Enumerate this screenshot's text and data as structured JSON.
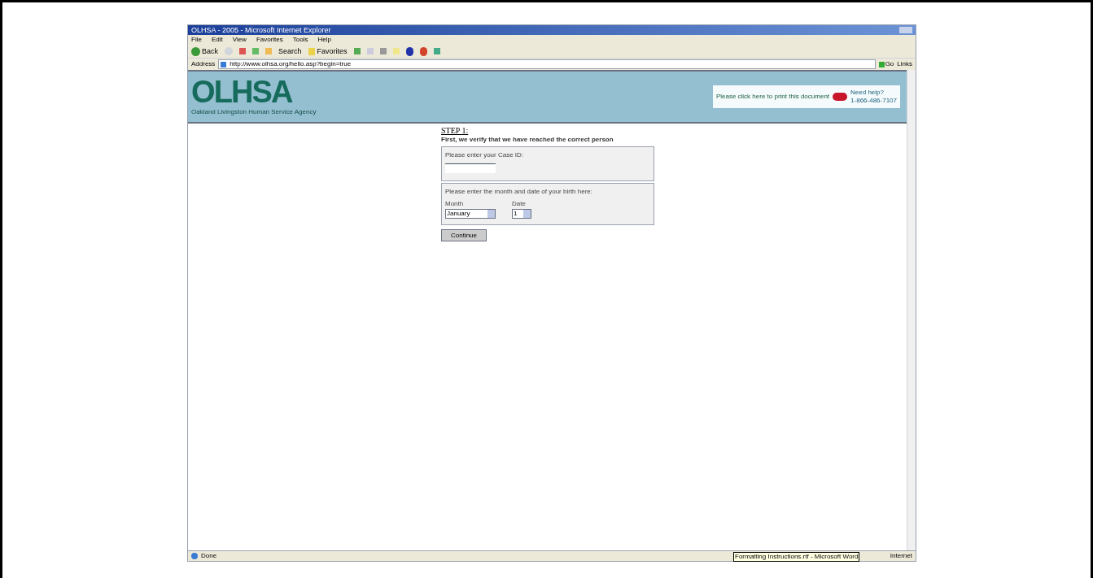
{
  "window": {
    "title": "OLHSA - 2005 - Microsoft Internet Explorer"
  },
  "menu": [
    "File",
    "Edit",
    "View",
    "Favorites",
    "Tools",
    "Help"
  ],
  "toolbar": {
    "back": "Back",
    "search": "Search",
    "favorites": "Favorites"
  },
  "address_bar": {
    "label": "Address",
    "value": "http://www.olhsa.org/hello.asp?begin=true",
    "go": "Go",
    "links": "Links"
  },
  "header": {
    "logo": "OLHSA",
    "tagline": "Oakland Livingston Human Service Agency",
    "print_link": "Please click here to print this document",
    "help_title": "Need help?",
    "help_phone": "1-866-486-7107"
  },
  "form": {
    "step": "STEP 1:",
    "intro": "First, we verify that we have reached the correct person",
    "case_label": "Please enter your Case ID:",
    "birth_label": "Please enter the month and date of your birth here:",
    "month_label": "Month",
    "month_value": "January",
    "date_label": "Date",
    "date_value": "1",
    "submit": "Continue"
  },
  "status_bar": {
    "text": "Done",
    "zone": "Internet"
  },
  "tooltip": "Formatting Instructions.rtf - Microsoft Word"
}
